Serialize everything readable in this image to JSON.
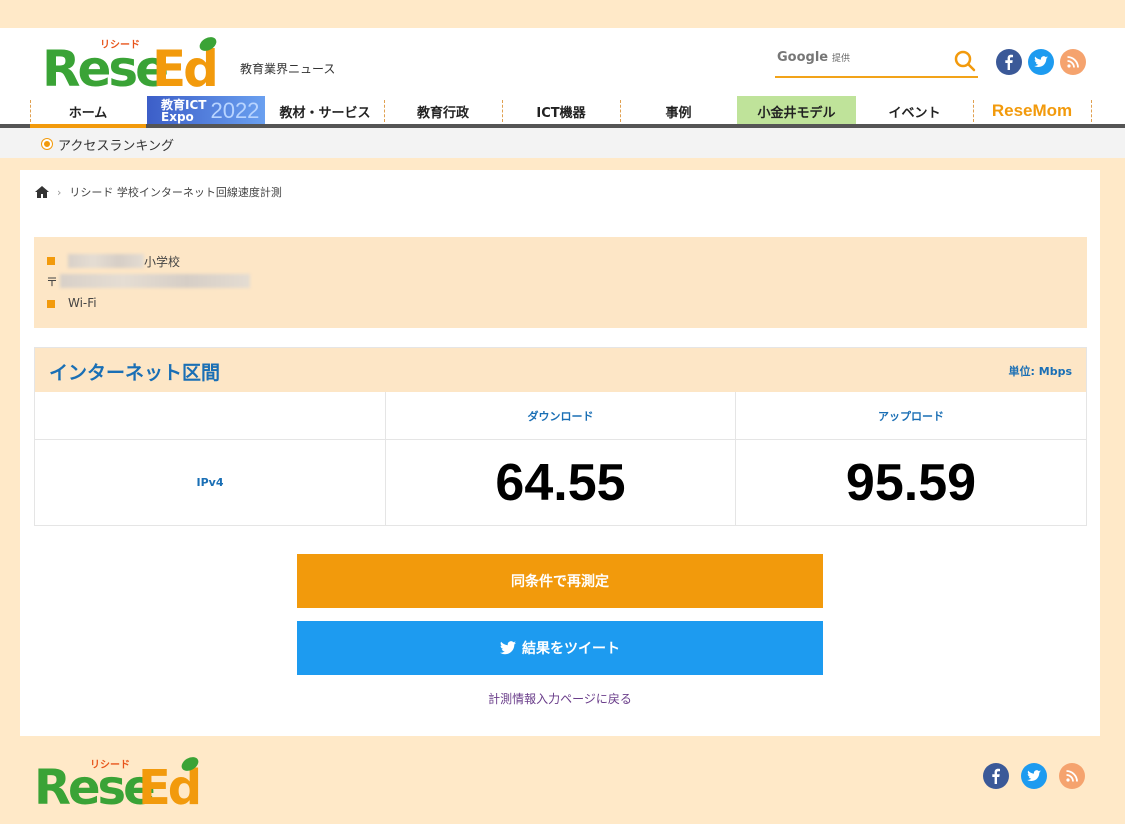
{
  "header": {
    "logo_kana": "リシード",
    "tagline": "教育業界ニュース",
    "search": {
      "brand": "Google",
      "provided": "提供"
    }
  },
  "nav": {
    "items": [
      {
        "label": "ホーム"
      },
      {
        "label": "教育ICT",
        "sub": "Expo",
        "year": "2022"
      },
      {
        "label": "教材・サービス"
      },
      {
        "label": "教育行政"
      },
      {
        "label": "ICT機器"
      },
      {
        "label": "事例"
      },
      {
        "label": "小金井モデル"
      },
      {
        "label": "イベント"
      },
      {
        "label": "ReseMom"
      }
    ],
    "sub_label": "アクセスランキング"
  },
  "breadcrumb": {
    "current": "リシード 学校インターネット回線速度計測"
  },
  "info": {
    "school_suffix": "小学校",
    "postal_mark": "〒",
    "connection": "Wi-Fi"
  },
  "result": {
    "title": "インターネット区間",
    "unit": "単位: Mbps",
    "col_download": "ダウンロード",
    "col_upload": "アップロード",
    "row_label": "IPv4",
    "download": "64.55",
    "upload": "95.59"
  },
  "actions": {
    "remeasure": "同条件で再測定",
    "tweet": "結果をツイート",
    "back": "計測情報入力ページに戻る"
  },
  "footer": {
    "logo_kana": "リシード"
  },
  "colors": {
    "accent": "#f29a0c",
    "blue": "#1a6fb5",
    "twitter": "#1d9bf0",
    "bg": "#ffe9c8"
  }
}
